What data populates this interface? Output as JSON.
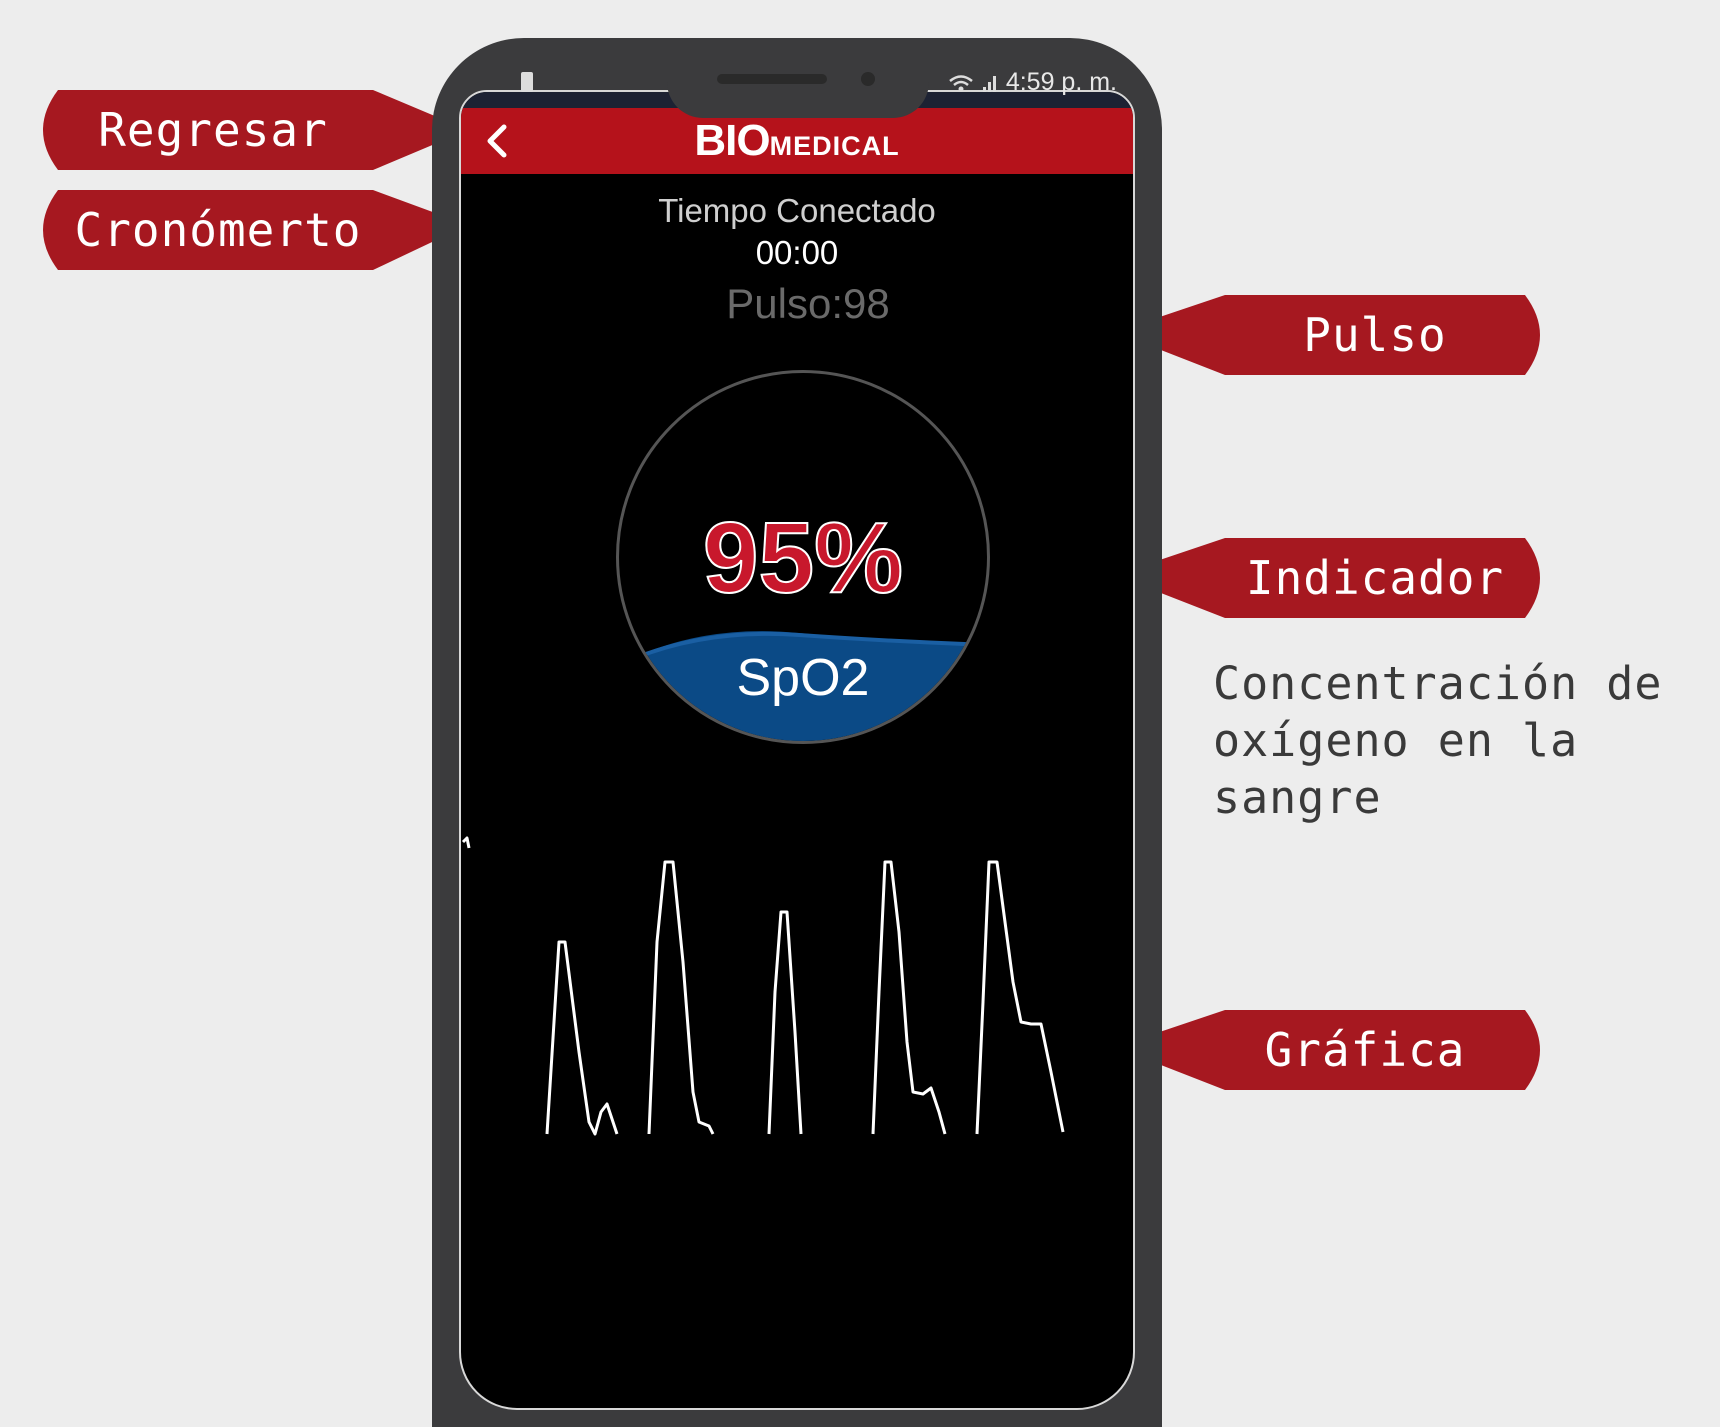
{
  "annotations": {
    "back": "Regresar",
    "timer": "Cronómerto",
    "pulse": "Pulso",
    "indicator": "Indicador",
    "indicator_desc_line1": "Concentración de",
    "indicator_desc_line2": "oxígeno en la sangre",
    "graph": "Gráfica"
  },
  "status_bar": {
    "time": "4:59 p. m."
  },
  "app_bar": {
    "logo_bold": "BIO",
    "logo_small": "MEDICAL"
  },
  "timer": {
    "label": "Tiempo Conectado",
    "value": "00:00"
  },
  "pulse": {
    "text": "Pulso:98"
  },
  "gauge": {
    "value_text": "95%",
    "label": "SpO2",
    "value": 95
  },
  "colors": {
    "accent": "#b5121b",
    "callout": "#a61820",
    "gauge_fill": "#0b4a86",
    "background": "#000000"
  }
}
